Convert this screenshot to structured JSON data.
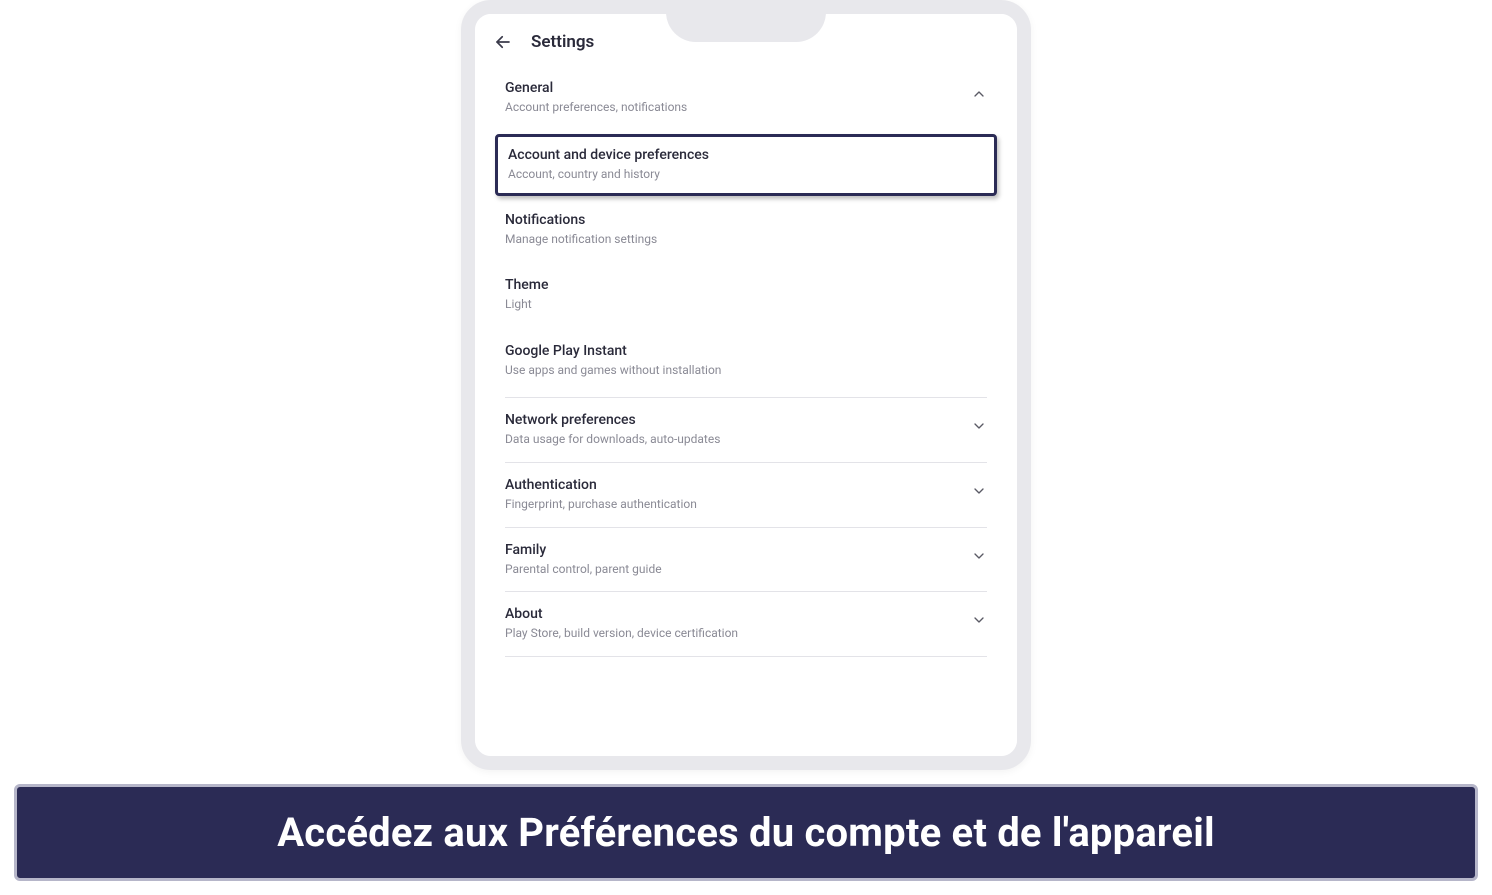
{
  "header": {
    "title": "Settings"
  },
  "general": {
    "title": "General",
    "subtitle": "Account preferences, notifications"
  },
  "account_prefs": {
    "title": "Account and device preferences",
    "subtitle": "Account, country and history"
  },
  "notifications": {
    "title": "Notifications",
    "subtitle": "Manage notification settings"
  },
  "theme": {
    "title": "Theme",
    "subtitle": "Light"
  },
  "play_instant": {
    "title": "Google Play Instant",
    "subtitle": "Use apps and games without installation"
  },
  "network": {
    "title": "Network preferences",
    "subtitle": "Data usage for downloads, auto-updates"
  },
  "auth": {
    "title": "Authentication",
    "subtitle": "Fingerprint, purchase authentication"
  },
  "family": {
    "title": "Family",
    "subtitle": "Parental control, parent guide"
  },
  "about": {
    "title": "About",
    "subtitle": "Play Store, build version, device certification"
  },
  "caption": "Accédez aux Préférences du compte et de l'appareil"
}
